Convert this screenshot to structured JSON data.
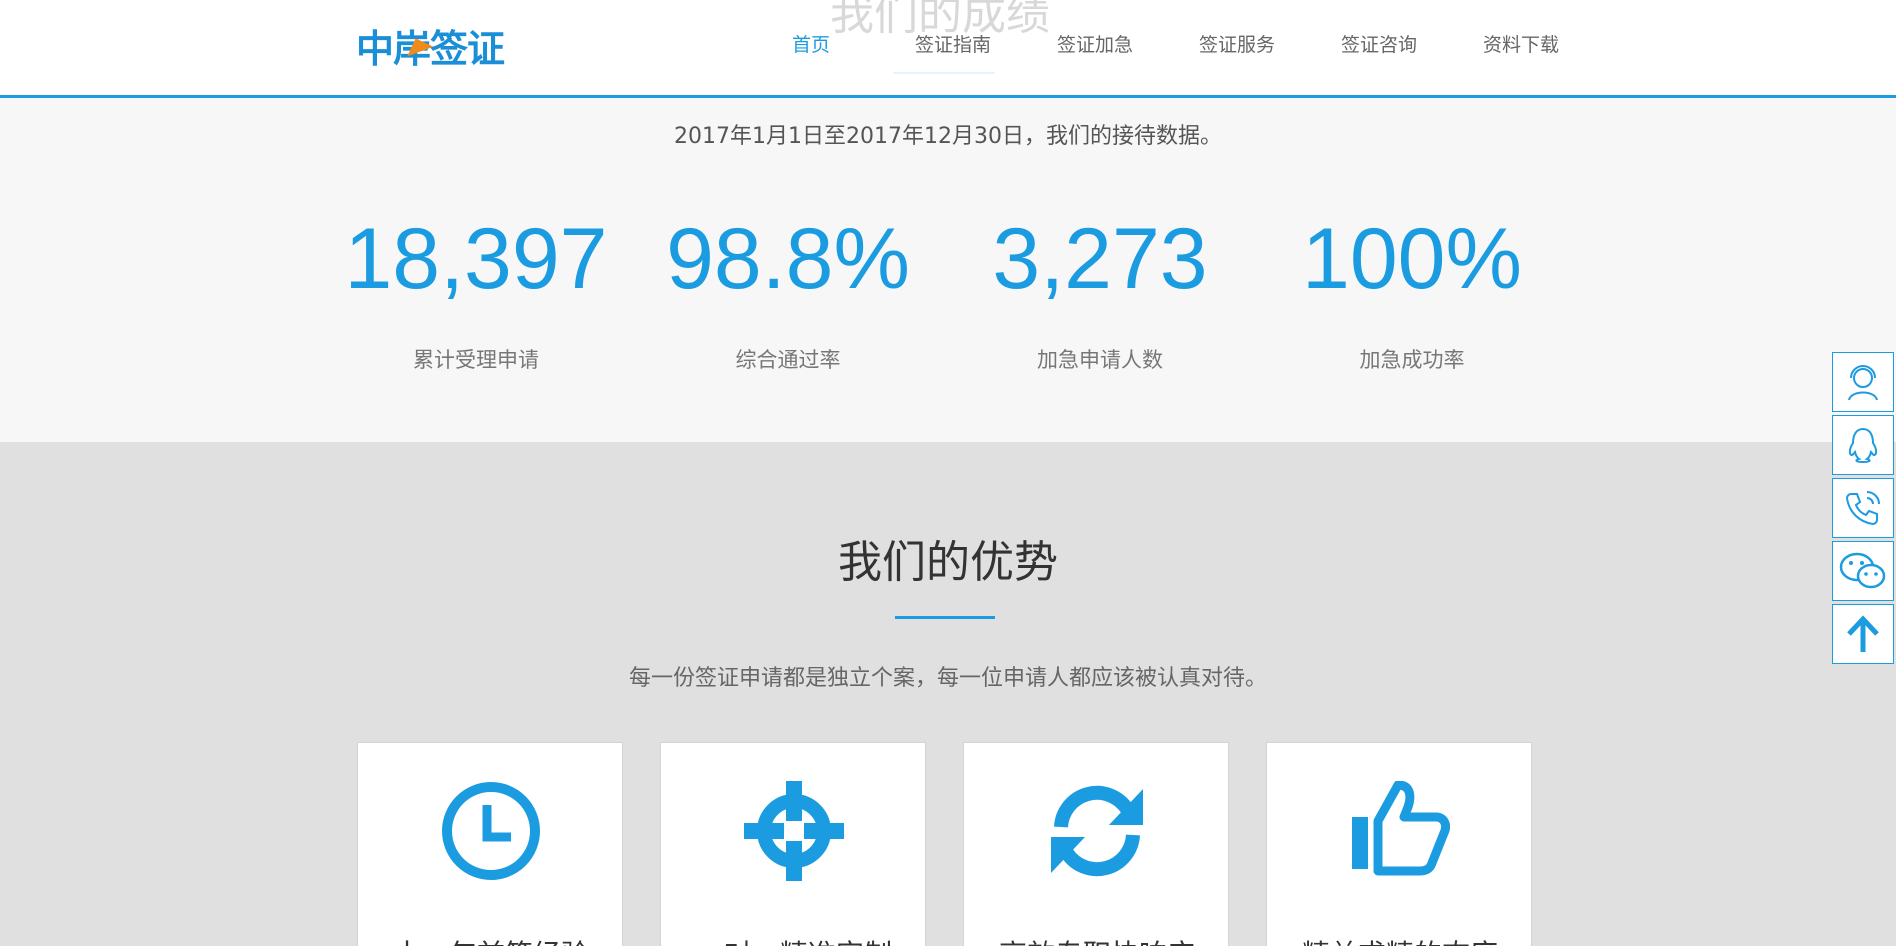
{
  "header": {
    "ghost_title": "我们的成绩",
    "logo_text": "中岸签证",
    "nav": [
      {
        "label": "首页",
        "active": true
      },
      {
        "label": "签证指南",
        "active": false
      },
      {
        "label": "签证加急",
        "active": false
      },
      {
        "label": "签证服务",
        "active": false
      },
      {
        "label": "签证咨询",
        "active": false
      },
      {
        "label": "资料下载",
        "active": false
      }
    ]
  },
  "stats": {
    "subtitle": "2017年1月1日至2017年12月30日，我们的接待数据。",
    "items": [
      {
        "value": "18,397",
        "label": "累计受理申请"
      },
      {
        "value": "98.8%",
        "label": "综合通过率"
      },
      {
        "value": "3,273",
        "label": "加急申请人数"
      },
      {
        "value": "100%",
        "label": "加急成功率"
      }
    ]
  },
  "advantages": {
    "title": "我们的优势",
    "subtitle": "每一份签证申请都是独立个案，每一位申请人都应该被认真对待。",
    "cards": [
      {
        "icon": "clock-icon",
        "title": "十一年前签经验"
      },
      {
        "icon": "target-icon",
        "title": "一对一精准定制"
      },
      {
        "icon": "refresh-icon",
        "title": "高效专职快响应"
      },
      {
        "icon": "thumbs-up-icon",
        "title": "精益求精的态度"
      }
    ]
  },
  "sidebar": [
    {
      "icon": "customer-service-icon"
    },
    {
      "icon": "qq-icon"
    },
    {
      "icon": "phone-icon"
    },
    {
      "icon": "wechat-icon"
    },
    {
      "icon": "back-to-top-icon"
    }
  ],
  "colors": {
    "accent": "#1c9ce0",
    "logo_orange": "#f08a1c"
  }
}
